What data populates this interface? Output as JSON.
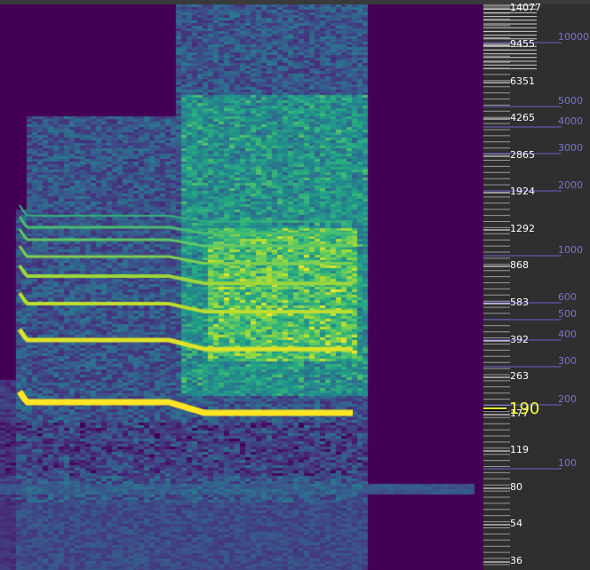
{
  "spectrogram": {
    "description_icon": "spectrogram-view",
    "colormap": [
      "#440154",
      "#472d7b",
      "#3b528b",
      "#2c728e",
      "#21918c",
      "#28ae80",
      "#5ec962",
      "#addc30",
      "#fde725"
    ]
  },
  "note_scale": {
    "labels": [
      "14077",
      "9455",
      "6351",
      "4265",
      "2865",
      "1924",
      "1292",
      "868",
      "583",
      "392",
      "263",
      "177",
      "119",
      "80",
      "54",
      "36"
    ]
  },
  "frequency_scale": {
    "labels": [
      "10000",
      "5000",
      "4000",
      "3000",
      "2000",
      "1000",
      "600",
      "500",
      "400",
      "300",
      "200",
      "100"
    ]
  },
  "pitch_cursor": {
    "value": "190"
  },
  "colors": {
    "background": "#2f2f2f",
    "note_line": "#ffffff",
    "frequency_line": "#6a62cf",
    "cursor": "#ffff33"
  }
}
